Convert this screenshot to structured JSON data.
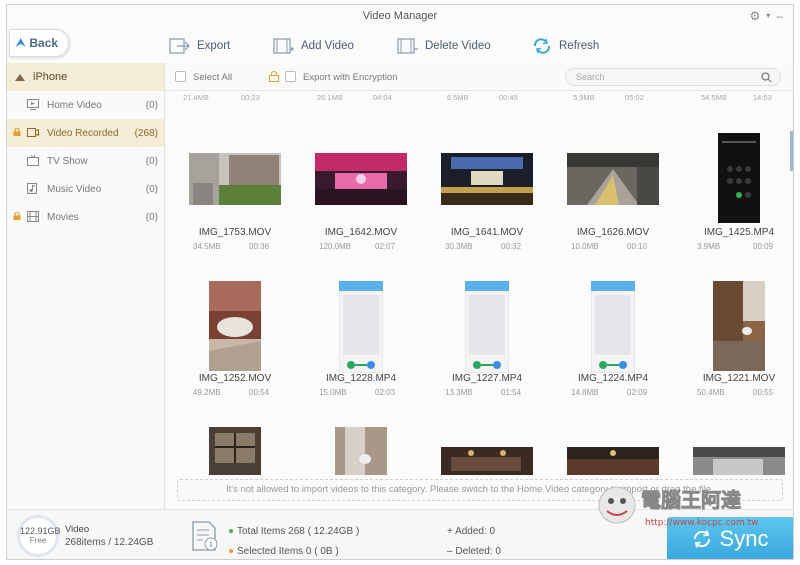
{
  "app": {
    "title": "Video Manager"
  },
  "toolbar": {
    "back_label": "Back",
    "export_label": "Export",
    "add_label": "Add Video",
    "delete_label": "Delete Video",
    "refresh_label": "Refresh"
  },
  "sidebar": {
    "device": "iPhone",
    "items": [
      {
        "label": "Home Video",
        "count": "(0)",
        "icon": "home-video-icon",
        "locked": false
      },
      {
        "label": "Video Recorded",
        "count": "(268)",
        "icon": "video-recorded-icon",
        "locked": true
      },
      {
        "label": "TV Show",
        "count": "(0)",
        "icon": "tv-icon",
        "locked": false
      },
      {
        "label": "Music Video",
        "count": "(0)",
        "icon": "music-video-icon",
        "locked": false
      },
      {
        "label": "Movies",
        "count": "(0)",
        "icon": "movie-icon",
        "locked": true
      }
    ]
  },
  "content_header": {
    "select_all": "Select All",
    "export_encryption": "Export with Encryption",
    "search_placeholder": "Search"
  },
  "top_row_partial": [
    {
      "size": "21.4MB",
      "duration": "00:23"
    },
    {
      "size": "26.1MB",
      "duration": "04:04"
    },
    {
      "size": "6.5MB",
      "duration": "00:45"
    },
    {
      "size": "5.9MB",
      "duration": "05:02"
    },
    {
      "size": "54.5MB",
      "duration": "14:53"
    }
  ],
  "videos": [
    {
      "name": "IMG_1753.MOV",
      "size": "34.5MB",
      "duration": "00:36"
    },
    {
      "name": "IMG_1642.MOV",
      "size": "120.0MB",
      "duration": "02:07"
    },
    {
      "name": "IMG_1641.MOV",
      "size": "30.3MB",
      "duration": "00:32"
    },
    {
      "name": "IMG_1626.MOV",
      "size": "10.0MB",
      "duration": "00:10"
    },
    {
      "name": "IMG_1425.MP4",
      "size": "3.9MB",
      "duration": "00:09"
    },
    {
      "name": "IMG_1252.MOV",
      "size": "49.2MB",
      "duration": "00:54"
    },
    {
      "name": "IMG_1228.MP4",
      "size": "15.0MB",
      "duration": "02:03"
    },
    {
      "name": "IMG_1227.MP4",
      "size": "13.3MB",
      "duration": "01:54"
    },
    {
      "name": "IMG_1224.MP4",
      "size": "14.8MB",
      "duration": "02:09"
    },
    {
      "name": "IMG_1221.MOV",
      "size": "50.4MB",
      "duration": "00:55"
    }
  ],
  "notice": "It's not allowed to import videos to this category.  Please switch to the Home Video category to import or drag the file.",
  "status": {
    "storage_free": "122.91GB",
    "free_label": "Free",
    "type_label": "Video",
    "items_summary": "268items / 12.24GB",
    "total_items": "Total Items 268 ( 12.24GB )",
    "selected_items": "Selected Items 0 ( 0B )",
    "added": "Added: 0",
    "deleted": "Deleted: 0",
    "sync_label": "Sync"
  },
  "watermark": {
    "text": "電腦王阿達",
    "url": "http://www.kocpc.com.tw"
  },
  "colors": {
    "accent": "#3aa7de",
    "sidebar_active": "#f6edd7",
    "green_dot": "#4caf50",
    "orange_dot": "#f0a030"
  }
}
